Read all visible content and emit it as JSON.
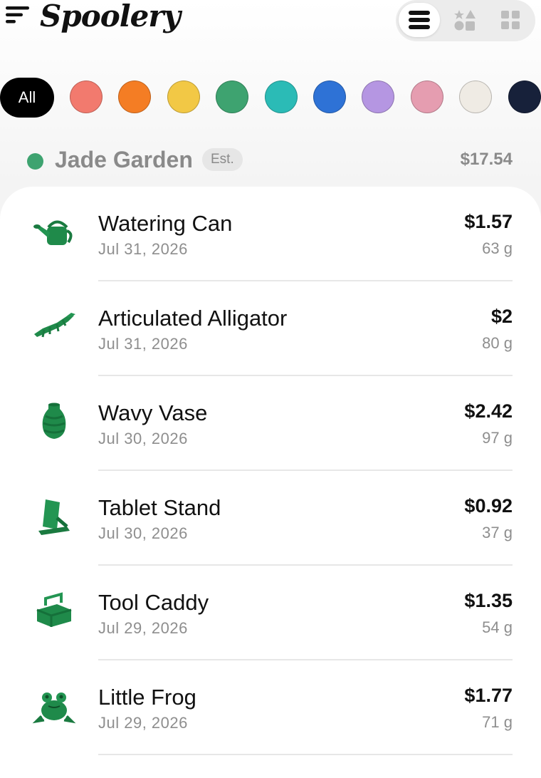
{
  "app": {
    "brand": "Spoolery"
  },
  "view_toggle": {
    "options": [
      "list",
      "shapes",
      "grid"
    ],
    "active": "list"
  },
  "color_filter": {
    "all_label": "All",
    "swatches": [
      {
        "name": "salmon",
        "color": "#f27a6e"
      },
      {
        "name": "orange",
        "color": "#f47d24"
      },
      {
        "name": "yellow",
        "color": "#f2c845"
      },
      {
        "name": "green",
        "color": "#3ea370"
      },
      {
        "name": "teal",
        "color": "#2bbbb6"
      },
      {
        "name": "blue",
        "color": "#2e72d6"
      },
      {
        "name": "lavender",
        "color": "#b596e2"
      },
      {
        "name": "pink",
        "color": "#e59db0"
      },
      {
        "name": "cream",
        "color": "#efebe4"
      },
      {
        "name": "navy",
        "color": "#17213a"
      }
    ]
  },
  "group": {
    "dot_color": "#3ea370",
    "name": "Jade Garden",
    "badge": "Est.",
    "total": "$17.54"
  },
  "prints": [
    {
      "icon": "watering-can-icon",
      "title": "Watering Can",
      "date": "Jul 31, 2026",
      "price": "$1.57",
      "weight": "63 g"
    },
    {
      "icon": "alligator-icon",
      "title": "Articulated Alligator",
      "date": "Jul 31, 2026",
      "price": "$2",
      "weight": "80 g"
    },
    {
      "icon": "vase-icon",
      "title": "Wavy Vase",
      "date": "Jul 30, 2026",
      "price": "$2.42",
      "weight": "97 g"
    },
    {
      "icon": "tablet-stand-icon",
      "title": "Tablet Stand",
      "date": "Jul 30, 2026",
      "price": "$0.92",
      "weight": "37 g"
    },
    {
      "icon": "tool-caddy-icon",
      "title": "Tool Caddy",
      "date": "Jul 29, 2026",
      "price": "$1.35",
      "weight": "54 g"
    },
    {
      "icon": "frog-icon",
      "title": "Little Frog",
      "date": "Jul 29, 2026",
      "price": "$1.77",
      "weight": "71 g"
    }
  ],
  "accent_green": "#1f8a4a"
}
